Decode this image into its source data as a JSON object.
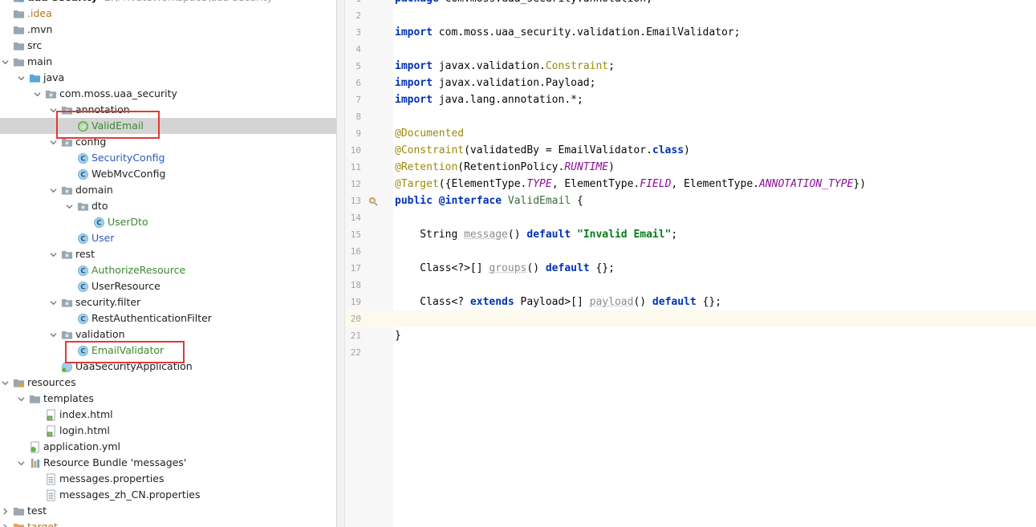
{
  "project": {
    "root_name": "uaa-security",
    "root_path": "E:\\PrivateWorkspace\\uaa-security"
  },
  "tree": [
    {
      "label": "uaa-security",
      "suffix": "E:\\PrivateWorkspace\\uaa-security",
      "icon": "module-icon",
      "depth": 0,
      "arrow": "none",
      "style": "bold"
    },
    {
      "label": ".idea",
      "icon": "folder-icon",
      "depth": 0,
      "arrow": "none",
      "style": "orange"
    },
    {
      "label": ".mvn",
      "icon": "folder-icon",
      "depth": 0,
      "arrow": "none",
      "style": ""
    },
    {
      "label": "src",
      "icon": "folder-icon",
      "depth": 0,
      "arrow": "none",
      "style": ""
    },
    {
      "label": "main",
      "icon": "folder-icon",
      "depth": 1,
      "arrow": "down",
      "style": ""
    },
    {
      "label": "java",
      "icon": "source-folder-icon",
      "depth": 2,
      "arrow": "down",
      "style": ""
    },
    {
      "label": "com.moss.uaa_security",
      "icon": "package-icon",
      "depth": 3,
      "arrow": "down",
      "style": ""
    },
    {
      "label": "annotation",
      "icon": "package-icon",
      "depth": 4,
      "arrow": "down",
      "style": ""
    },
    {
      "label": "ValidEmail",
      "icon": "annotation-icon",
      "depth": 5,
      "arrow": "none",
      "style": "green",
      "selected": true
    },
    {
      "label": "config",
      "icon": "package-icon",
      "depth": 4,
      "arrow": "down",
      "style": ""
    },
    {
      "label": "SecurityConfig",
      "icon": "class-icon",
      "depth": 5,
      "arrow": "none",
      "style": "blue"
    },
    {
      "label": "WebMvcConfig",
      "icon": "class-icon",
      "depth": 5,
      "arrow": "none",
      "style": ""
    },
    {
      "label": "domain",
      "icon": "package-icon",
      "depth": 4,
      "arrow": "down",
      "style": ""
    },
    {
      "label": "dto",
      "icon": "package-icon",
      "depth": 5,
      "arrow": "down",
      "style": ""
    },
    {
      "label": "UserDto",
      "icon": "class-icon",
      "depth": 6,
      "arrow": "none",
      "style": "green"
    },
    {
      "label": "User",
      "icon": "class-icon",
      "depth": 5,
      "arrow": "none",
      "style": "blue"
    },
    {
      "label": "rest",
      "icon": "package-icon",
      "depth": 4,
      "arrow": "down",
      "style": ""
    },
    {
      "label": "AuthorizeResource",
      "icon": "class-icon",
      "depth": 5,
      "arrow": "none",
      "style": "green"
    },
    {
      "label": "UserResource",
      "icon": "class-icon",
      "depth": 5,
      "arrow": "none",
      "style": ""
    },
    {
      "label": "security.filter",
      "icon": "package-icon",
      "depth": 4,
      "arrow": "down",
      "style": ""
    },
    {
      "label": "RestAuthenticationFilter",
      "icon": "class-icon",
      "depth": 5,
      "arrow": "none",
      "style": ""
    },
    {
      "label": "validation",
      "icon": "package-icon",
      "depth": 4,
      "arrow": "down",
      "style": ""
    },
    {
      "label": "EmailValidator",
      "icon": "class-icon",
      "depth": 5,
      "arrow": "none",
      "style": "green"
    },
    {
      "label": "UaaSecurityApplication",
      "icon": "spring-class-icon",
      "depth": 4,
      "arrow": "none",
      "style": ""
    },
    {
      "label": "resources",
      "icon": "resources-folder-icon",
      "depth": 1,
      "arrow": "down",
      "style": ""
    },
    {
      "label": "templates",
      "icon": "folder-icon",
      "depth": 2,
      "arrow": "down",
      "style": ""
    },
    {
      "label": "index.html",
      "icon": "html-file-icon",
      "depth": 3,
      "arrow": "none",
      "style": ""
    },
    {
      "label": "login.html",
      "icon": "html-file-icon",
      "depth": 3,
      "arrow": "none",
      "style": ""
    },
    {
      "label": "application.yml",
      "icon": "yaml-file-icon",
      "depth": 2,
      "arrow": "none",
      "style": ""
    },
    {
      "label": "Resource Bundle 'messages'",
      "icon": "resource-bundle-icon",
      "depth": 2,
      "arrow": "down",
      "style": ""
    },
    {
      "label": "messages.properties",
      "icon": "properties-file-icon",
      "depth": 3,
      "arrow": "none",
      "style": ""
    },
    {
      "label": "messages_zh_CN.properties",
      "icon": "properties-file-icon",
      "depth": 3,
      "arrow": "none",
      "style": ""
    },
    {
      "label": "test",
      "icon": "folder-icon",
      "depth": 1,
      "arrow": "right",
      "style": ""
    },
    {
      "label": "target",
      "icon": "excluded-folder-icon",
      "depth": 0,
      "arrow": "right",
      "style": "orange"
    }
  ],
  "editor": {
    "file_name": "ValidEmail",
    "current_line": 20,
    "lines": [
      [
        {
          "t": "package ",
          "c": "kw"
        },
        {
          "t": "com.moss.uaa_security.annotation;",
          "c": ""
        }
      ],
      [],
      [
        {
          "t": "import ",
          "c": "kw"
        },
        {
          "t": "com.moss.uaa_security.validation.EmailValidator;",
          "c": ""
        }
      ],
      [],
      [
        {
          "t": "import ",
          "c": "kw"
        },
        {
          "t": "javax.validation.",
          "c": ""
        },
        {
          "t": "Constraint",
          "c": "ann"
        },
        {
          "t": ";",
          "c": ""
        }
      ],
      [
        {
          "t": "import ",
          "c": "kw"
        },
        {
          "t": "javax.validation.Payload;",
          "c": ""
        }
      ],
      [
        {
          "t": "import ",
          "c": "kw"
        },
        {
          "t": "java.lang.annotation.*;",
          "c": ""
        }
      ],
      [],
      [
        {
          "t": "@Documented",
          "c": "ann"
        }
      ],
      [
        {
          "t": "@Constraint",
          "c": "ann"
        },
        {
          "t": "(validatedBy = EmailValidator.",
          "c": ""
        },
        {
          "t": "class",
          "c": "kw"
        },
        {
          "t": ")",
          "c": ""
        }
      ],
      [
        {
          "t": "@Retention",
          "c": "ann"
        },
        {
          "t": "(RetentionPolicy.",
          "c": ""
        },
        {
          "t": "RUNTIME",
          "c": "const"
        },
        {
          "t": ")",
          "c": ""
        }
      ],
      [
        {
          "t": "@Target",
          "c": "ann"
        },
        {
          "t": "({ElementType.",
          "c": ""
        },
        {
          "t": "TYPE",
          "c": "const"
        },
        {
          "t": ", ElementType.",
          "c": ""
        },
        {
          "t": "FIELD",
          "c": "const"
        },
        {
          "t": ", ElementType.",
          "c": ""
        },
        {
          "t": "ANNOTATION_TYPE",
          "c": "const"
        },
        {
          "t": "})",
          "c": ""
        }
      ],
      [
        {
          "t": "public ",
          "c": "kw"
        },
        {
          "t": "@interface ",
          "c": "kw"
        },
        {
          "t": "ValidEmail",
          "c": "type-decl"
        },
        {
          "t": " {",
          "c": ""
        }
      ],
      [],
      [
        {
          "t": "    String ",
          "c": ""
        },
        {
          "t": "message",
          "c": "unused"
        },
        {
          "t": "() ",
          "c": ""
        },
        {
          "t": "default ",
          "c": "kw"
        },
        {
          "t": "\"Invalid Email\"",
          "c": "str"
        },
        {
          "t": ";",
          "c": ""
        }
      ],
      [],
      [
        {
          "t": "    Class<?>[] ",
          "c": ""
        },
        {
          "t": "groups",
          "c": "unused"
        },
        {
          "t": "() ",
          "c": ""
        },
        {
          "t": "default ",
          "c": "kw"
        },
        {
          "t": "{};",
          "c": ""
        }
      ],
      [],
      [
        {
          "t": "    Class<? ",
          "c": ""
        },
        {
          "t": "extends ",
          "c": "kw"
        },
        {
          "t": "Payload>[] ",
          "c": ""
        },
        {
          "t": "payload",
          "c": "unused"
        },
        {
          "t": "() ",
          "c": ""
        },
        {
          "t": "default ",
          "c": "kw"
        },
        {
          "t": "{};",
          "c": ""
        }
      ],
      [],
      [
        {
          "t": "}",
          "c": ""
        }
      ],
      []
    ]
  },
  "gutter_icons": [
    {
      "line": 13,
      "icon": "implemented-marker-icon"
    }
  ],
  "colors": {
    "highlight_box": "#e03a3a",
    "selection": "#d4d4d4",
    "keyword": "#0033b3",
    "annotation": "#9e880d",
    "string": "#067d17"
  }
}
